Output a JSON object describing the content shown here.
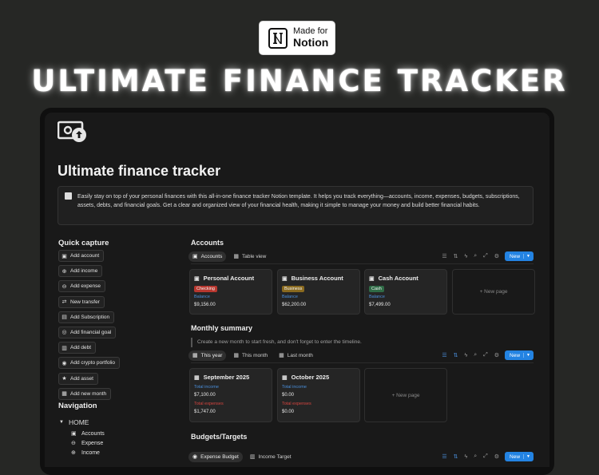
{
  "badge": {
    "line1": "Made for",
    "line2": "Notion"
  },
  "hero_title": "ULTIMATE FINANCE TRACKER",
  "page": {
    "title": "Ultimate finance tracker",
    "callout": "Easily stay on top of your personal finances with this all-in-one finance tracker Notion template. It helps you track everything—accounts, income, expenses, budgets, subscriptions, assets, debts, and financial goals. Get a clear and organized view of your financial health, making it simple to manage your money and build better financial habits."
  },
  "quick_capture": {
    "heading": "Quick capture",
    "buttons": [
      {
        "label": "Add account",
        "icon": "wallet-icon"
      },
      {
        "label": "Add income",
        "icon": "income-icon"
      },
      {
        "label": "Add expense",
        "icon": "expense-icon"
      },
      {
        "label": "New transfer",
        "icon": "transfer-icon"
      },
      {
        "label": "Add Subscription",
        "icon": "subscription-icon"
      },
      {
        "label": "Add financial goal",
        "icon": "goal-icon"
      },
      {
        "label": "Add debt",
        "icon": "debt-icon"
      },
      {
        "label": "Add crypto portfolio",
        "icon": "crypto-icon"
      },
      {
        "label": "Add asset",
        "icon": "star-icon"
      },
      {
        "label": "Add new month",
        "icon": "calendar-icon"
      }
    ]
  },
  "navigation": {
    "heading": "Navigation",
    "home": "HOME",
    "items": [
      "Accounts",
      "Expense",
      "Income"
    ]
  },
  "accounts": {
    "heading": "Accounts",
    "tabs": [
      "Accounts",
      "Table view"
    ],
    "new_label": "New",
    "cards": [
      {
        "name": "Personal  Account",
        "tag": "Checking",
        "tag_color": "#b8372f",
        "balance_label": "Balance",
        "balance": "$9,156.00"
      },
      {
        "name": "Business Account",
        "tag": "Business",
        "tag_color": "#8a6a1f",
        "balance_label": "Balance",
        "balance": "$62,200.00"
      },
      {
        "name": "Cash Account",
        "tag": "Cash",
        "tag_color": "#2f6b46",
        "balance_label": "Balance",
        "balance": "$7,499.00"
      }
    ],
    "new_page": "+  New page"
  },
  "monthly": {
    "heading": "Monthly summary",
    "note": "Create a new month to start fresh, and don't forget to enter the timeline.",
    "tabs": [
      "This year",
      "This month",
      "Last month"
    ],
    "new_label": "New",
    "cards": [
      {
        "name": "September 2025",
        "income_label": "Total income",
        "income": "$7,100.00",
        "expense_label": "Total expenses",
        "expense": "$1,747.00"
      },
      {
        "name": "October 2025",
        "income_label": "Total income",
        "income": "$0.00",
        "expense_label": "Total expenses",
        "expense": "$0.00"
      }
    ],
    "new_page": "+  New page"
  },
  "budgets": {
    "heading": "Budgets/Targets",
    "tabs": [
      "Expense Budget",
      "Income Target"
    ],
    "new_label": "New"
  },
  "colors": {
    "accent": "#2383e2",
    "income_label": "#4a8fdc",
    "expense_label": "#d6453f",
    "balance_label": "#4a8fdc"
  }
}
